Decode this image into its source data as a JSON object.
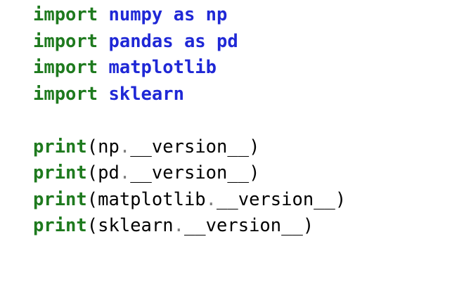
{
  "colors": {
    "keyword": "#1e7a1e",
    "module": "#1f28d6",
    "text": "#000000",
    "dim": "#7f7f7f",
    "background": "#ffffff"
  },
  "code": {
    "imports": [
      {
        "keyword": "import",
        "module": "numpy as np"
      },
      {
        "keyword": "import",
        "module": "pandas as pd"
      },
      {
        "keyword": "import",
        "module": "matplotlib"
      },
      {
        "keyword": "import",
        "module": "sklearn"
      }
    ],
    "prints": [
      {
        "func": "print",
        "open": "(",
        "target": "np",
        "dot": ".",
        "attr": "__version__",
        "close": ")"
      },
      {
        "func": "print",
        "open": "(",
        "target": "pd",
        "dot": ".",
        "attr": "__version__",
        "close": ")"
      },
      {
        "func": "print",
        "open": "(",
        "target": "matplotlib",
        "dot": ".",
        "attr": "__version__",
        "close": ")"
      },
      {
        "func": "print",
        "open": "(",
        "target": "sklearn",
        "dot": ".",
        "attr": "__version__",
        "close": ")"
      }
    ]
  }
}
